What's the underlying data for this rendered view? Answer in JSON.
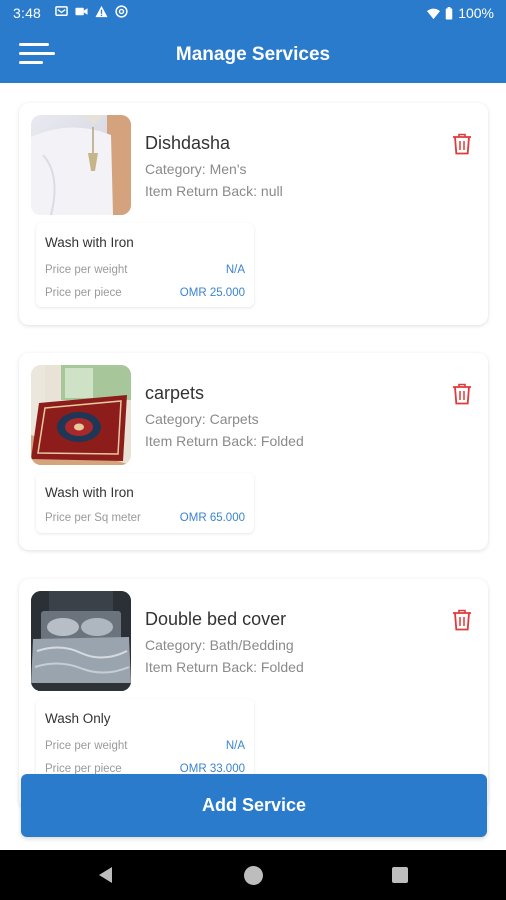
{
  "status_bar": {
    "time": "3:48",
    "battery": "100%",
    "icons": [
      "message-icon",
      "video-icon",
      "alert-icon",
      "at-sign-icon",
      "wifi-icon",
      "battery-icon"
    ]
  },
  "app_bar": {
    "title": "Manage Services",
    "menu_icon": "hamburger-menu-icon",
    "color": "#2b7bcc"
  },
  "services": [
    {
      "name": "Dishdasha",
      "category": "Category: Men's",
      "return_back": "Item Return Back: null",
      "image": "white-dishdasha-image",
      "pricing": {
        "title": "Wash with Iron",
        "rows": [
          {
            "label": "Price per weight",
            "value": "N/A"
          },
          {
            "label": "Price per piece",
            "value": "OMR 25.000"
          }
        ]
      }
    },
    {
      "name": "carpets",
      "category": "Category: Carpets",
      "return_back": "Item Return Back: Folded",
      "image": "red-carpet-image",
      "pricing": {
        "title": "Wash with Iron",
        "rows": [
          {
            "label": "Price per Sq meter",
            "value": "OMR 65.000"
          }
        ]
      }
    },
    {
      "name": "Double bed cover",
      "category": "Category: Bath/Bedding",
      "return_back": "Item Return Back: Folded",
      "image": "bed-cover-image",
      "pricing": {
        "title": "Wash Only",
        "rows": [
          {
            "label": "Price per weight",
            "value": "N/A"
          },
          {
            "label": "Price per piece",
            "value": "OMR 33.000"
          }
        ]
      }
    }
  ],
  "add_button": {
    "label": "Add Service"
  },
  "colors": {
    "accent": "#2b7bcc",
    "delete": "#e03a3a",
    "price": "#3a84cf"
  }
}
